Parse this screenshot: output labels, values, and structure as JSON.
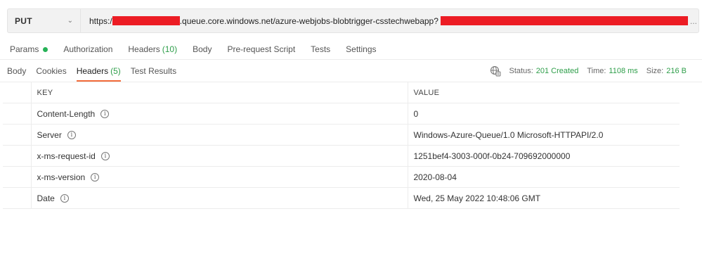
{
  "request": {
    "method": "PUT",
    "url_prefix": "https:/",
    "url_middle": ".queue.core.windows.net/azure-webjobs-blobtrigger-csstechwebapp?",
    "url_overflow": "..."
  },
  "request_tabs": [
    {
      "label": "Params",
      "has_dot": true
    },
    {
      "label": "Authorization"
    },
    {
      "label": "Headers",
      "count": "(10)"
    },
    {
      "label": "Body"
    },
    {
      "label": "Pre-request Script"
    },
    {
      "label": "Tests"
    },
    {
      "label": "Settings"
    }
  ],
  "response_tabs": [
    {
      "label": "Body"
    },
    {
      "label": "Cookies"
    },
    {
      "label": "Headers",
      "count": "(5)",
      "active": true
    },
    {
      "label": "Test Results"
    }
  ],
  "response_meta": {
    "status_label": "Status:",
    "status_value": "201 Created",
    "time_label": "Time:",
    "time_value": "1108 ms",
    "size_label": "Size:",
    "size_value": "216 B",
    "globe_icon": "globe-icon"
  },
  "table": {
    "columns": [
      "KEY",
      "VALUE"
    ],
    "rows": [
      {
        "key": "Content-Length",
        "value": "0"
      },
      {
        "key": "Server",
        "value": "Windows-Azure-Queue/1.0 Microsoft-HTTPAPI/2.0"
      },
      {
        "key": "x-ms-request-id",
        "value": "1251bef4-3003-000f-0b24-709692000000"
      },
      {
        "key": "x-ms-version",
        "value": "2020-08-04"
      },
      {
        "key": "Date",
        "value": "Wed, 25 May 2022 10:48:06 GMT"
      }
    ],
    "info_icon": "i"
  },
  "colors": {
    "accent": "#f26b3a",
    "success": "#2e9e4a",
    "redaction": "#ec1c24"
  }
}
